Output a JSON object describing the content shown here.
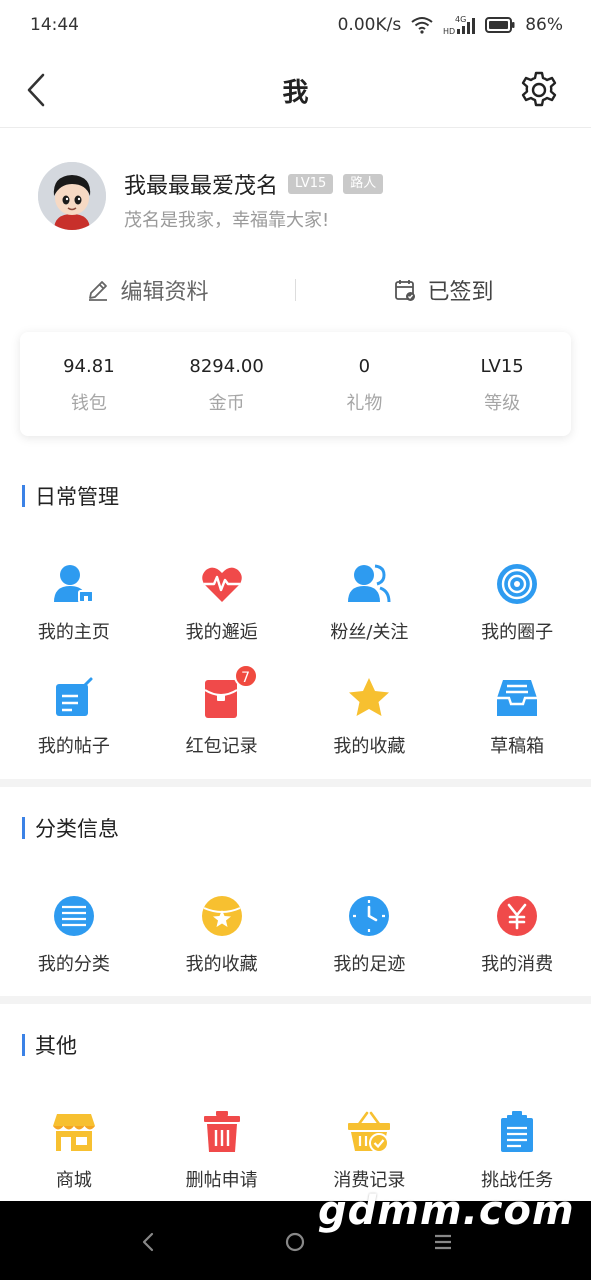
{
  "status_bar": {
    "time": "14:44",
    "speed": "0.00K/s",
    "network": "4G",
    "hd": "HD",
    "battery": "86%"
  },
  "nav": {
    "title": "我",
    "back_icon": "chevron-left-icon",
    "settings_icon": "gear-icon"
  },
  "profile": {
    "username": "我最最最爱茂名",
    "level_badge": "LV15",
    "role_badge": "路人",
    "signature": "茂名是我家，幸福靠大家!"
  },
  "actions": {
    "edit_label": "编辑资料",
    "checkin_label": "已签到"
  },
  "stats": [
    {
      "value": "94.81",
      "label": "钱包"
    },
    {
      "value": "8294.00",
      "label": "金币"
    },
    {
      "value": "0",
      "label": "礼物"
    },
    {
      "value": "LV15",
      "label": "等级"
    }
  ],
  "sections": {
    "daily": {
      "title": "日常管理",
      "items": [
        {
          "label": "我的主页",
          "icon": "user-home-icon"
        },
        {
          "label": "我的邂逅",
          "icon": "heartbeat-icon"
        },
        {
          "label": "粉丝/关注",
          "icon": "fans-icon"
        },
        {
          "label": "我的圈子",
          "icon": "circle-target-icon"
        },
        {
          "label": "我的帖子",
          "icon": "edit-post-icon"
        },
        {
          "label": "红包记录",
          "icon": "red-packet-icon",
          "badge": "7"
        },
        {
          "label": "我的收藏",
          "icon": "star-icon"
        },
        {
          "label": "草稿箱",
          "icon": "drafts-tray-icon"
        }
      ]
    },
    "category": {
      "title": "分类信息",
      "items": [
        {
          "label": "我的分类",
          "icon": "list-circle-icon"
        },
        {
          "label": "我的收藏",
          "icon": "favorite-star-circle-icon"
        },
        {
          "label": "我的足迹",
          "icon": "clock-icon"
        },
        {
          "label": "我的消费",
          "icon": "yuan-icon"
        }
      ]
    },
    "other": {
      "title": "其他",
      "items": [
        {
          "label": "商城",
          "icon": "shop-icon"
        },
        {
          "label": "删帖申请",
          "icon": "trash-icon"
        },
        {
          "label": "消费记录",
          "icon": "basket-check-icon"
        },
        {
          "label": "挑战任务",
          "icon": "clipboard-icon"
        }
      ]
    }
  },
  "colors": {
    "accent": "#3b82e6",
    "icon_blue": "#2e9bf0",
    "icon_red": "#f04a4a",
    "icon_yellow": "#f7c030"
  },
  "watermark": "gdmm.com"
}
